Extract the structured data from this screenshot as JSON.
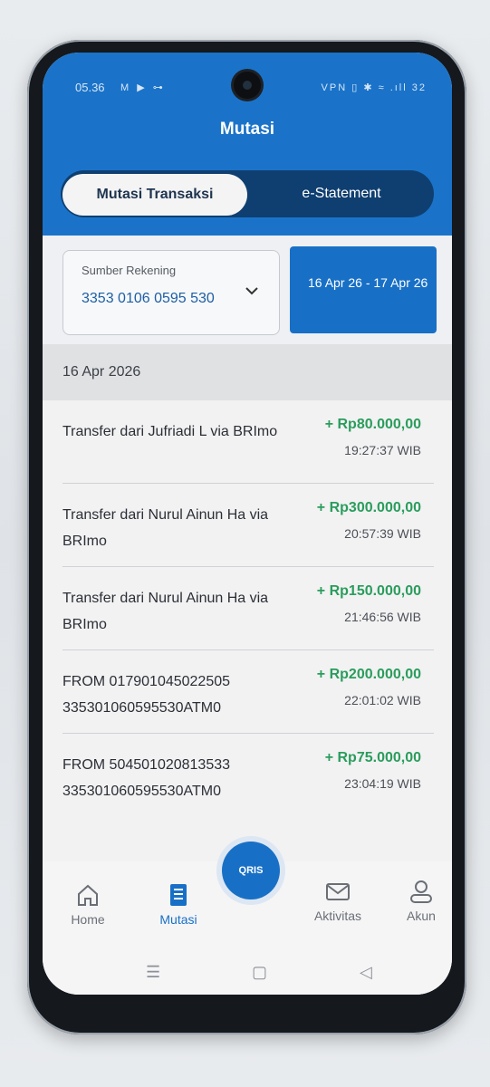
{
  "status": {
    "time": "05.36",
    "left_icons": "M ▶ ⊶",
    "right_icons": "VPN ▯ ✱ ≈ .ıll 32"
  },
  "app": {
    "title": "Mutasi"
  },
  "tabs": [
    {
      "label": "Mutasi Transaksi",
      "active": true
    },
    {
      "label": "e-Statement",
      "active": false
    }
  ],
  "filter": {
    "source_label": "Sumber Rekening",
    "source_value": "3353 0106 0595 530",
    "date_range": "16 Apr 26 - 17 Apr 26"
  },
  "list": {
    "date_header": "16 Apr 2026",
    "transactions": [
      {
        "desc": "Transfer dari Jufriadi L via BRImo",
        "amount": "+ Rp80.000,00",
        "time": "19:27:37 WIB"
      },
      {
        "desc": "Transfer dari Nurul Ainun Ha via BRImo",
        "amount": "+ Rp300.000,00",
        "time": "20:57:39 WIB"
      },
      {
        "desc": "Transfer dari Nurul Ainun Ha via BRImo",
        "amount": "+ Rp150.000,00",
        "time": "21:46:56 WIB"
      },
      {
        "desc": "FROM 017901045022505 335301060595530ATM0",
        "amount": "+ Rp200.000,00",
        "time": "22:01:02 WIB"
      },
      {
        "desc": "FROM 504501020813533 335301060595530ATM0",
        "amount": "+ Rp75.000,00",
        "time": "23:04:19 WIB"
      }
    ]
  },
  "nav": {
    "home": "Home",
    "mutasi": "Mutasi",
    "qris": "QRIS",
    "aktivitas": "Aktivitas",
    "akun": "Akun"
  },
  "colors": {
    "primary": "#1870c6",
    "credit": "#2a9d5c",
    "tab_bg": "#0f3f70"
  },
  "icons": {
    "home": "home-icon",
    "mutasi": "receipt-icon",
    "qris": "qris-scan-icon",
    "aktivitas": "mail-icon",
    "akun": "user-icon",
    "chevron": "chevron-down-icon"
  }
}
